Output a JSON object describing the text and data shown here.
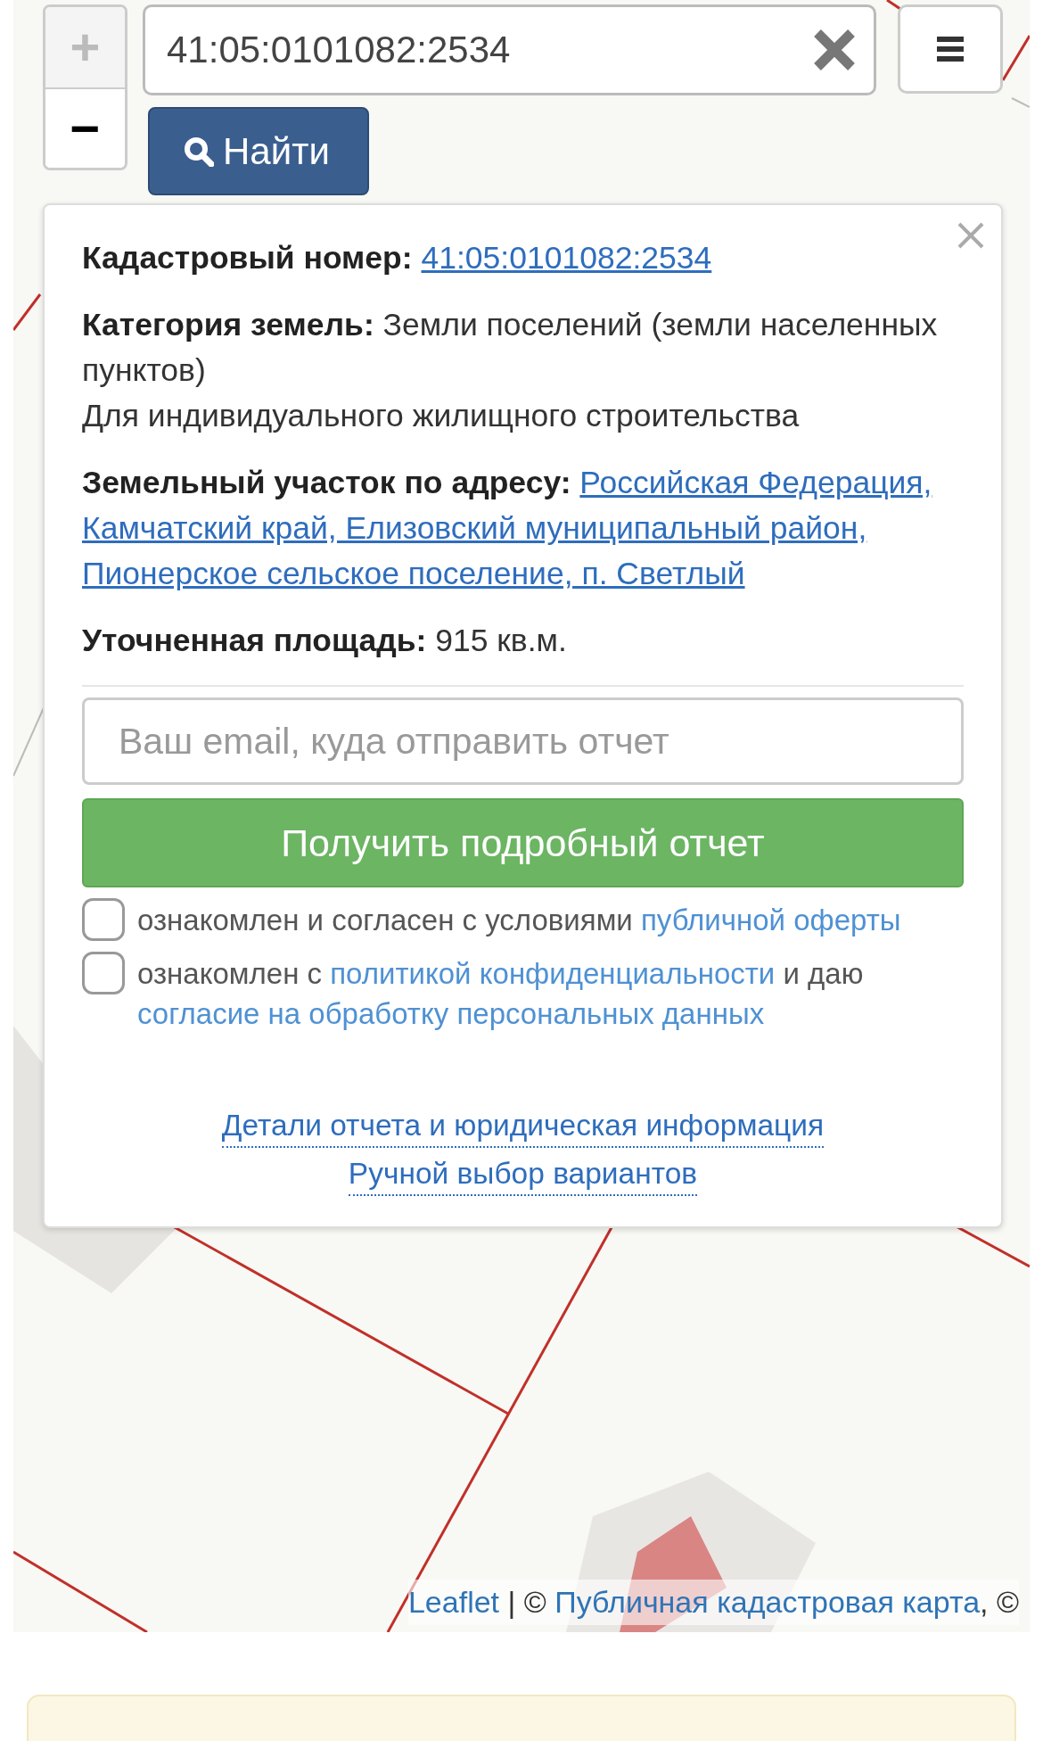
{
  "zoom_controls": {
    "zoom_in": {
      "label": "+",
      "disabled": true
    },
    "zoom_out": {
      "label": "−",
      "disabled": false
    }
  },
  "search": {
    "value": "41:05:0101082:2534"
  },
  "find_button": {
    "label": "Найти"
  },
  "popup": {
    "fields": [
      {
        "kind": "link",
        "label": "Кадастровый номер:",
        "value": "41:05:0101082:2534"
      },
      {
        "kind": "text",
        "label": "Категория земель:",
        "value": "Земли поселений (земли населенных пунктов)",
        "note": "Для индивидуального жилищного строительства"
      },
      {
        "kind": "link",
        "label": "Земельный участок по адресу:",
        "value": "Российская Федерация, Камчатский край, Елизовский муниципальный район, Пионерское сельское поселение, п. Светлый"
      },
      {
        "kind": "text",
        "label": "Уточненная площадь:",
        "value": "915 кв.м."
      }
    ],
    "email": {
      "placeholder": "Ваш email, куда отправить отчет"
    },
    "submit": {
      "label": "Получить подробный отчет"
    },
    "agreements": [
      {
        "checked": false,
        "parts": [
          {
            "kind": "text",
            "text": "ознакомлен и согласен с условиями "
          },
          {
            "kind": "link",
            "text": "публичной оферты"
          }
        ]
      },
      {
        "checked": false,
        "parts": [
          {
            "kind": "text",
            "text": "ознакомлен с "
          },
          {
            "kind": "link",
            "text": "политикой конфиденциальности"
          },
          {
            "kind": "text",
            "text": " и даю "
          },
          {
            "kind": "link",
            "text": "согласие на обработку персональных данных"
          }
        ]
      }
    ],
    "footer_links": [
      "Детали отчета и юридическая информация",
      "Ручной выбор вариантов"
    ]
  },
  "attribution": [
    {
      "kind": "link",
      "text": "Leaflet"
    },
    {
      "kind": "text",
      "text": " | © "
    },
    {
      "kind": "link",
      "text": "Публичная кадастровая карта"
    },
    {
      "kind": "text",
      "text": ", ©"
    }
  ]
}
